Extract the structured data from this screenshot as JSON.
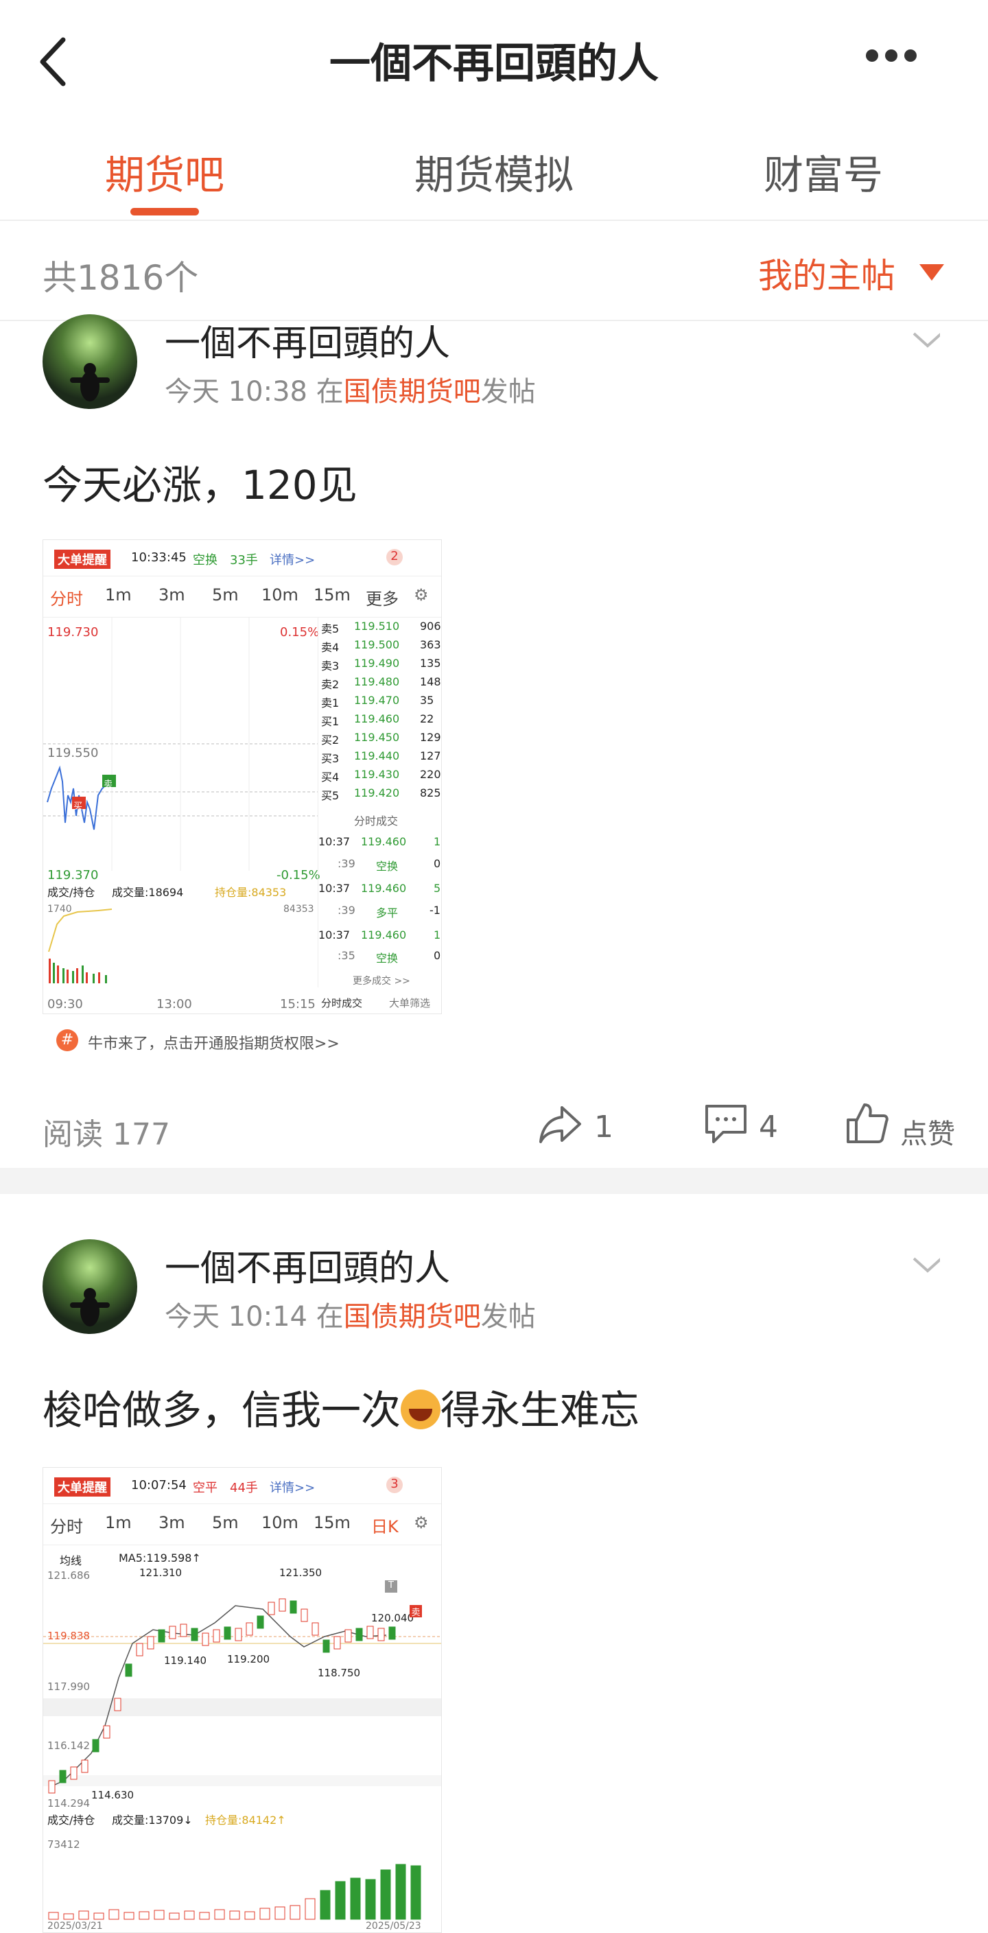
{
  "header": {
    "title": "一個不再回頭的人",
    "back_icon": "chevron-left-icon",
    "more_icon": "more-dots-icon"
  },
  "tabs": [
    {
      "label": "期货吧",
      "active": true
    },
    {
      "label": "期货模拟",
      "active": false
    },
    {
      "label": "财富号",
      "active": false
    }
  ],
  "filter_bar": {
    "count": "共1816个",
    "filter_label": "我的主帖"
  },
  "colors": {
    "accent": "#e8552d"
  },
  "posts": [
    {
      "author": "一個不再回頭的人",
      "time": "今天 10:38",
      "in": "在",
      "bar": "国债期货吧",
      "post_suffix": "发帖",
      "content": "今天必涨，120见",
      "reads": "阅读 177",
      "shares": "1",
      "comments": "4",
      "like_label": "点赞",
      "screenshot": {
        "alert_badge": "大单提醒",
        "alert_time": "10:33:45",
        "alert_type": "空换",
        "alert_hands": "33手",
        "alert_detail": "详情>>",
        "alert_count": "2",
        "tabs": [
          "分时",
          "1m",
          "3m",
          "5m",
          "10m",
          "15m",
          "更多"
        ],
        "price_high": "119.730",
        "pct_high": "0.15%",
        "price_mid": "119.550",
        "price_low": "119.370",
        "pct_low": "-0.15%",
        "buy_mark": "买",
        "sell_mark": "卖",
        "order_book": [
          {
            "label": "卖5",
            "price": "119.510",
            "vol": "906"
          },
          {
            "label": "卖4",
            "price": "119.500",
            "vol": "363"
          },
          {
            "label": "卖3",
            "price": "119.490",
            "vol": "135"
          },
          {
            "label": "卖2",
            "price": "119.480",
            "vol": "148"
          },
          {
            "label": "卖1",
            "price": "119.470",
            "vol": "35"
          },
          {
            "label": "买1",
            "price": "119.460",
            "vol": "22"
          },
          {
            "label": "买2",
            "price": "119.450",
            "vol": "129"
          },
          {
            "label": "买3",
            "price": "119.440",
            "vol": "127"
          },
          {
            "label": "买4",
            "price": "119.430",
            "vol": "220"
          },
          {
            "label": "买5",
            "price": "119.420",
            "vol": "825"
          }
        ],
        "trades_title": "分时成交",
        "trades": [
          {
            "time": "10:37",
            "sec": ":39",
            "price": "119.460",
            "qty": "1",
            "type": "空换",
            "delta": "0"
          },
          {
            "time": "10:37",
            "sec": ":39",
            "price": "119.460",
            "qty": "5",
            "type": "多平",
            "delta": "-1"
          },
          {
            "time": "10:37",
            "sec": ":35",
            "price": "119.460",
            "qty": "1",
            "type": "空换",
            "delta": "0"
          }
        ],
        "more_trades": "更多成交 >>",
        "bottom_tabs": [
          "分时成交",
          "大单筛选"
        ],
        "vol_label": "成交/持仓",
        "vol_value": "成交量:18694",
        "oi_value": "持仓量:84353",
        "vol_left": "1740",
        "vol_right": "84353",
        "time_axis": [
          "09:30",
          "13:00",
          "15:15"
        ],
        "promo": "牛市来了，点击开通股指期货权限>>"
      }
    },
    {
      "author": "一個不再回頭的人",
      "time": "今天 10:14",
      "in": "在",
      "bar": "国债期货吧",
      "post_suffix": "发帖",
      "content_before": "梭哈做多，信我一次",
      "content_after": "得永生难忘",
      "emoji": "laughing-emoji",
      "screenshot": {
        "alert_badge": "大单提醒",
        "alert_time": "10:07:54",
        "alert_type": "空平",
        "alert_hands": "44手",
        "alert_detail": "详情>>",
        "alert_count": "3",
        "tabs": [
          "分时",
          "1m",
          "3m",
          "5m",
          "10m",
          "15m",
          "日K"
        ],
        "ma_label": "均线",
        "ma_value": "MA5:119.598↑",
        "price_labels": [
          "121.686",
          "121.310",
          "121.350",
          "119.838",
          "120.040",
          "119.140",
          "119.200",
          "118.750",
          "117.990",
          "116.142",
          "114.630",
          "114.294"
        ],
        "vol_label": "成交/持仓",
        "vol_value": "成交量:13709↓",
        "oi_value": "持仓量:84142↑",
        "vol_left": "73412",
        "date_axis": [
          "2025/03/21",
          "2025/05/23"
        ],
        "mark_t": "T",
        "mark_sell": "卖"
      }
    }
  ]
}
